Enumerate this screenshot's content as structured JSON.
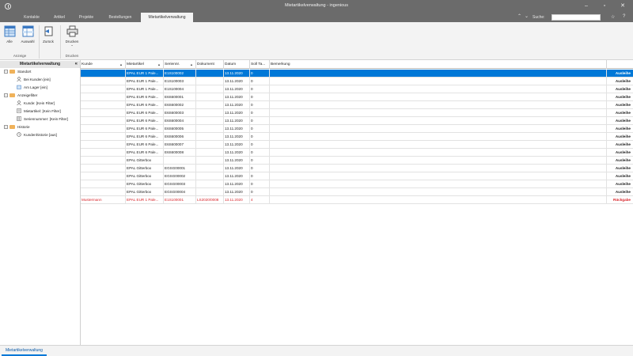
{
  "window": {
    "title": "Mietartikelverwaltung - ingenious"
  },
  "tabs": [
    {
      "label": "Kontakte"
    },
    {
      "label": "Artikel"
    },
    {
      "label": "Projekte"
    },
    {
      "label": "Bestellungen"
    },
    {
      "label": "Mietartikelverwaltung"
    }
  ],
  "search": {
    "label": "Suche:",
    "value": ""
  },
  "ribbon": {
    "alle_label": "Alle",
    "auswahl_label": "Auswahl",
    "zurueck_label": "Zurück",
    "drucken_label": "Drucken",
    "anzeige_group": "Anzeige",
    "drucken_group": "Drucken"
  },
  "leftpanel": {
    "title": "Mietartikelverwaltung",
    "collapse_glyph": "«",
    "tree": [
      {
        "label": "Standort",
        "type": "folder",
        "expander": "−"
      },
      {
        "label": "Bei Kunden [ein]",
        "type": "leaf"
      },
      {
        "label": "Am Lager [ein]",
        "type": "leaf"
      },
      {
        "label": "Anzeigefilter",
        "type": "folder",
        "expander": "−"
      },
      {
        "label": "Kunde: [Kein Filter]",
        "type": "leaf"
      },
      {
        "label": "Mietartikel: [Kein Filter]",
        "type": "leaf"
      },
      {
        "label": "Seriennummer: [Kein Filter]",
        "type": "leaf"
      },
      {
        "label": "Historie",
        "type": "folder",
        "expander": "−"
      },
      {
        "label": "Kundenhistorie [aus]",
        "type": "leaf"
      }
    ]
  },
  "grid": {
    "columns": [
      "Kunde",
      "Mietartikel",
      "Seriennr.",
      "Dokument",
      "Datum",
      "Soll Ta...",
      "Bemerkung",
      ""
    ],
    "rows": [
      {
        "kunde": "",
        "artikel": "EPAL EUR 1 Pale...",
        "serie": "E1S100002",
        "dokument": "",
        "datum": "13.11.2020",
        "soll": "0",
        "bemerkung": "",
        "aktion": "Ausleihe",
        "state": "sel"
      },
      {
        "kunde": "",
        "artikel": "EPAL EUR 1 Pale...",
        "serie": "E1S100003",
        "dokument": "",
        "datum": "13.11.2020",
        "soll": "0",
        "bemerkung": "",
        "aktion": "Ausleihe",
        "state": ""
      },
      {
        "kunde": "",
        "artikel": "EPAL EUR 1 Pale...",
        "serie": "E1S100004",
        "dokument": "",
        "datum": "13.11.2020",
        "soll": "0",
        "bemerkung": "",
        "aktion": "Ausleihe",
        "state": ""
      },
      {
        "kunde": "",
        "artikel": "EPAL EUR 6 Pale...",
        "serie": "E6S600001",
        "dokument": "",
        "datum": "13.11.2020",
        "soll": "0",
        "bemerkung": "",
        "aktion": "Ausleihe",
        "state": ""
      },
      {
        "kunde": "",
        "artikel": "EPAL EUR 6 Pale...",
        "serie": "E6S600002",
        "dokument": "",
        "datum": "13.11.2020",
        "soll": "0",
        "bemerkung": "",
        "aktion": "Ausleihe",
        "state": ""
      },
      {
        "kunde": "",
        "artikel": "EPAL EUR 6 Pale...",
        "serie": "E6S600003",
        "dokument": "",
        "datum": "13.11.2020",
        "soll": "0",
        "bemerkung": "",
        "aktion": "Ausleihe",
        "state": ""
      },
      {
        "kunde": "",
        "artikel": "EPAL EUR 6 Pale...",
        "serie": "E6S600004",
        "dokument": "",
        "datum": "13.11.2020",
        "soll": "0",
        "bemerkung": "",
        "aktion": "Ausleihe",
        "state": ""
      },
      {
        "kunde": "",
        "artikel": "EPAL EUR 6 Pale...",
        "serie": "E6S600005",
        "dokument": "",
        "datum": "13.11.2020",
        "soll": "0",
        "bemerkung": "",
        "aktion": "Ausleihe",
        "state": ""
      },
      {
        "kunde": "",
        "artikel": "EPAL EUR 6 Pale...",
        "serie": "E6S600006",
        "dokument": "",
        "datum": "13.11.2020",
        "soll": "0",
        "bemerkung": "",
        "aktion": "Ausleihe",
        "state": ""
      },
      {
        "kunde": "",
        "artikel": "EPAL EUR 6 Pale...",
        "serie": "E6S600007",
        "dokument": "",
        "datum": "13.11.2020",
        "soll": "0",
        "bemerkung": "",
        "aktion": "Ausleihe",
        "state": ""
      },
      {
        "kunde": "",
        "artikel": "EPAL EUR 6 Pale...",
        "serie": "E6S600008",
        "dokument": "",
        "datum": "13.11.2020",
        "soll": "0",
        "bemerkung": "",
        "aktion": "Ausleihe",
        "state": ""
      },
      {
        "kunde": "",
        "artikel": "EPAL Gitterbox",
        "serie": "",
        "dokument": "",
        "datum": "13.11.2020",
        "soll": "0",
        "bemerkung": "",
        "aktion": "Ausleihe",
        "state": ""
      },
      {
        "kunde": "",
        "artikel": "EPAL Gitterbox",
        "serie": "EGSG00001",
        "dokument": "",
        "datum": "13.11.2020",
        "soll": "0",
        "bemerkung": "",
        "aktion": "Ausleihe",
        "state": ""
      },
      {
        "kunde": "",
        "artikel": "EPAL Gitterbox",
        "serie": "EGSG00002",
        "dokument": "",
        "datum": "13.11.2020",
        "soll": "0",
        "bemerkung": "",
        "aktion": "Ausleihe",
        "state": ""
      },
      {
        "kunde": "",
        "artikel": "EPAL Gitterbox",
        "serie": "EGSG00003",
        "dokument": "",
        "datum": "13.11.2020",
        "soll": "0",
        "bemerkung": "",
        "aktion": "Ausleihe",
        "state": ""
      },
      {
        "kunde": "",
        "artikel": "EPAL Gitterbox",
        "serie": "EGSG00004",
        "dokument": "",
        "datum": "13.11.2020",
        "soll": "0",
        "bemerkung": "",
        "aktion": "Ausleihe",
        "state": ""
      },
      {
        "kunde": "Mustermann",
        "artikel": "EPAL EUR 1 Pale...",
        "serie": "E1S100001",
        "dokument": "LS2020/0008",
        "datum": "13.11.2020",
        "soll": "4",
        "bemerkung": "",
        "aktion": "Rückgabe",
        "state": "red"
      }
    ]
  },
  "bottom": {
    "tab_label": "Mietartikelverwaltung"
  },
  "colors": {
    "titlebar": "#6b6b6b",
    "selection": "#0078d7",
    "returned": "#d8262c",
    "folder": "#f0b25a"
  },
  "icons": [
    "app-icon",
    "minimize-icon",
    "maximize-icon",
    "close-icon",
    "chevron-up-icon",
    "chevron-down-icon",
    "star-icon",
    "help-icon",
    "grid-all-icon",
    "grid-selection-icon",
    "back-icon",
    "printer-icon",
    "folder-icon",
    "user-icon",
    "warehouse-icon",
    "history-icon"
  ]
}
